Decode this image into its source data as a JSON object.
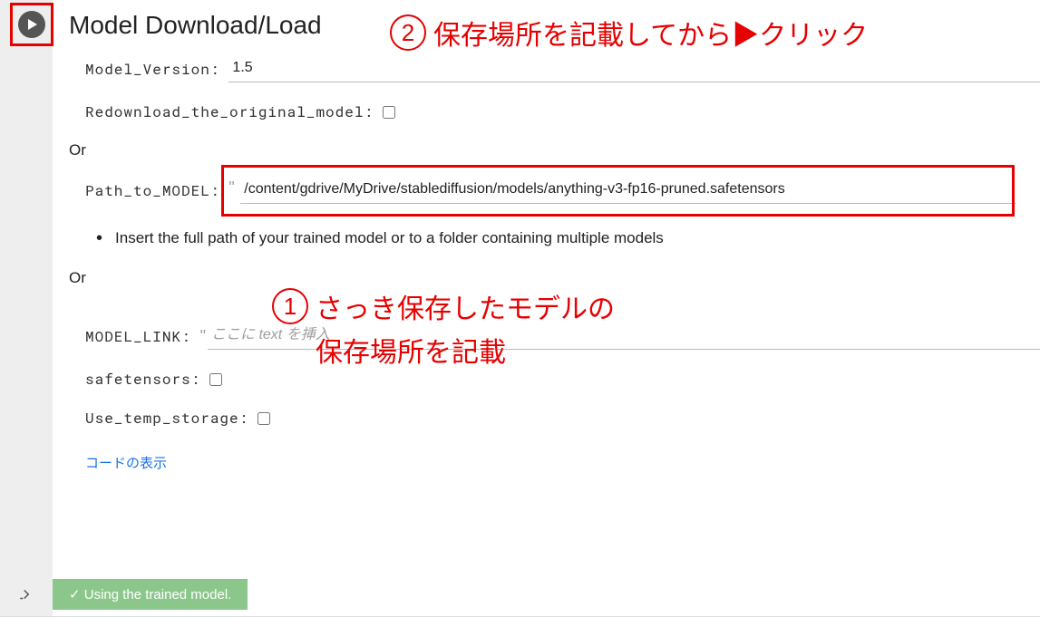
{
  "cell": {
    "title": "Model Download/Load",
    "fields": {
      "model_version": {
        "label": "Model_Version:",
        "value": "1.5"
      },
      "redownload": {
        "label": "Redownload_the_original_model:",
        "checked": false
      },
      "or1": "Or",
      "path_to_model": {
        "label": "Path_to_MODEL:",
        "value": "/content/gdrive/MyDrive/stablediffusion/models/anything-v3-fp16-pruned.safetensors"
      },
      "bullet": "Insert the full path of your trained model or to a folder containing multiple models",
      "or2": "Or",
      "model_link": {
        "label": "MODEL_LINK:",
        "placeholder": "ここに text を挿入"
      },
      "safetensors": {
        "label": "safetensors:",
        "checked": false
      },
      "use_temp": {
        "label": "Use_temp_storage:",
        "checked": false
      }
    },
    "show_code": "コードの表示",
    "output": "✓ Using the trained model."
  },
  "annotations": {
    "top": {
      "num": "2",
      "text": "保存場所を記載してから▶クリック"
    },
    "mid": {
      "num": "1",
      "line1": "さっき保存したモデルの",
      "line2": "保存場所を記載"
    }
  }
}
